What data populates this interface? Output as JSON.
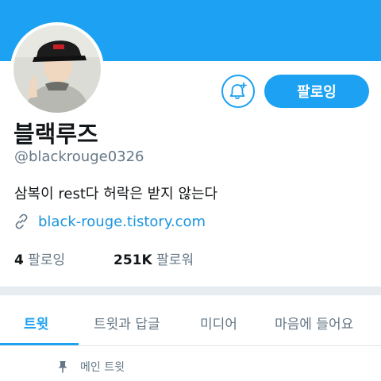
{
  "profile": {
    "display_name": "블랙루즈",
    "handle": "@blackrouge0326",
    "bio": "삼복이 rest다 허락은 받지 않는다",
    "link": "black-rouge.tistory.com"
  },
  "actions": {
    "follow_label": "팔로잉"
  },
  "stats": {
    "following_count": "4",
    "following_label": " 팔로잉",
    "followers_count": "251K",
    "followers_label": " 팔로워"
  },
  "tabs": [
    {
      "label": "트윗"
    },
    {
      "label": "트윗과 답글"
    },
    {
      "label": "미디어"
    },
    {
      "label": "마음에 들어요"
    }
  ],
  "pinned": {
    "label": "메인 트윗"
  },
  "colors": {
    "accent": "#1da1f2",
    "link": "#1b95e0",
    "secondary_text": "#657786"
  },
  "icons": [
    "bell-plus-icon",
    "link-icon",
    "pin-icon"
  ]
}
